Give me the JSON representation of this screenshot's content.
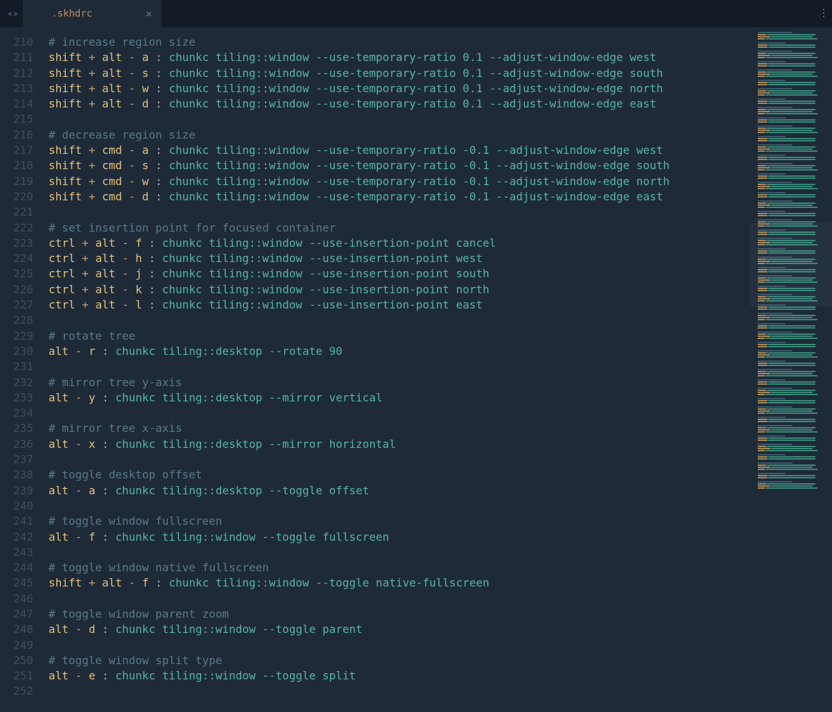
{
  "tab": {
    "filename": ".skhdrc",
    "modified": true
  },
  "first_line_num": 210,
  "lines": [
    {
      "type": "comment",
      "text": "# increase region size"
    },
    {
      "type": "bind",
      "mods": [
        "shift",
        "alt"
      ],
      "key": "a",
      "cmd": "chunkc tiling::window --use-temporary-ratio 0.1 --adjust-window-edge west"
    },
    {
      "type": "bind",
      "mods": [
        "shift",
        "alt"
      ],
      "key": "s",
      "cmd": "chunkc tiling::window --use-temporary-ratio 0.1 --adjust-window-edge south"
    },
    {
      "type": "bind",
      "mods": [
        "shift",
        "alt"
      ],
      "key": "w",
      "cmd": "chunkc tiling::window --use-temporary-ratio 0.1 --adjust-window-edge north"
    },
    {
      "type": "bind",
      "mods": [
        "shift",
        "alt"
      ],
      "key": "d",
      "cmd": "chunkc tiling::window --use-temporary-ratio 0.1 --adjust-window-edge east"
    },
    {
      "type": "blank"
    },
    {
      "type": "comment",
      "text": "# decrease region size"
    },
    {
      "type": "bind",
      "mods": [
        "shift",
        "cmd"
      ],
      "key": "a",
      "cmd": "chunkc tiling::window --use-temporary-ratio -0.1 --adjust-window-edge west"
    },
    {
      "type": "bind",
      "mods": [
        "shift",
        "cmd"
      ],
      "key": "s",
      "cmd": "chunkc tiling::window --use-temporary-ratio -0.1 --adjust-window-edge south"
    },
    {
      "type": "bind",
      "mods": [
        "shift",
        "cmd"
      ],
      "key": "w",
      "cmd": "chunkc tiling::window --use-temporary-ratio -0.1 --adjust-window-edge north"
    },
    {
      "type": "bind",
      "mods": [
        "shift",
        "cmd"
      ],
      "key": "d",
      "cmd": "chunkc tiling::window --use-temporary-ratio -0.1 --adjust-window-edge east"
    },
    {
      "type": "blank"
    },
    {
      "type": "comment",
      "text": "# set insertion point for focused container"
    },
    {
      "type": "bind",
      "mods": [
        "ctrl",
        "alt"
      ],
      "key": "f",
      "cmd": "chunkc tiling::window --use-insertion-point cancel"
    },
    {
      "type": "bind",
      "mods": [
        "ctrl",
        "alt"
      ],
      "key": "h",
      "cmd": "chunkc tiling::window --use-insertion-point west"
    },
    {
      "type": "bind",
      "mods": [
        "ctrl",
        "alt"
      ],
      "key": "j",
      "cmd": "chunkc tiling::window --use-insertion-point south"
    },
    {
      "type": "bind",
      "mods": [
        "ctrl",
        "alt"
      ],
      "key": "k",
      "cmd": "chunkc tiling::window --use-insertion-point north"
    },
    {
      "type": "bind",
      "mods": [
        "ctrl",
        "alt"
      ],
      "key": "l",
      "cmd": "chunkc tiling::window --use-insertion-point east"
    },
    {
      "type": "blank"
    },
    {
      "type": "comment",
      "text": "# rotate tree"
    },
    {
      "type": "bind",
      "mods": [
        "alt"
      ],
      "key": "r",
      "cmd": "chunkc tiling::desktop --rotate 90"
    },
    {
      "type": "blank"
    },
    {
      "type": "comment",
      "text": "# mirror tree y-axis"
    },
    {
      "type": "bind",
      "mods": [
        "alt"
      ],
      "key": "y",
      "cmd": "chunkc tiling::desktop --mirror vertical"
    },
    {
      "type": "blank"
    },
    {
      "type": "comment",
      "text": "# mirror tree x-axis"
    },
    {
      "type": "bind",
      "mods": [
        "alt"
      ],
      "key": "x",
      "cmd": "chunkc tiling::desktop --mirror horizontal"
    },
    {
      "type": "blank"
    },
    {
      "type": "comment",
      "text": "# toggle desktop offset"
    },
    {
      "type": "bind",
      "mods": [
        "alt"
      ],
      "key": "a",
      "cmd": "chunkc tiling::desktop --toggle offset"
    },
    {
      "type": "blank"
    },
    {
      "type": "comment",
      "text": "# toggle window fullscreen"
    },
    {
      "type": "bind",
      "mods": [
        "alt"
      ],
      "key": "f",
      "cmd": "chunkc tiling::window --toggle fullscreen"
    },
    {
      "type": "blank"
    },
    {
      "type": "comment",
      "text": "# toggle window native fullscreen"
    },
    {
      "type": "bind",
      "mods": [
        "shift",
        "alt"
      ],
      "key": "f",
      "cmd": "chunkc tiling::window --toggle native-fullscreen"
    },
    {
      "type": "blank"
    },
    {
      "type": "comment",
      "text": "# toggle window parent zoom"
    },
    {
      "type": "bind",
      "mods": [
        "alt"
      ],
      "key": "d",
      "cmd": "chunkc tiling::window --toggle parent"
    },
    {
      "type": "blank"
    },
    {
      "type": "comment",
      "text": "# toggle window split type"
    },
    {
      "type": "bind",
      "mods": [
        "alt"
      ],
      "key": "e",
      "cmd": "chunkc tiling::window --toggle split"
    },
    {
      "type": "blank"
    }
  ],
  "minimap_colors": {
    "comment": "#3a5a6a",
    "key": "#a88a5a",
    "cmd": "#3a8a7a"
  }
}
